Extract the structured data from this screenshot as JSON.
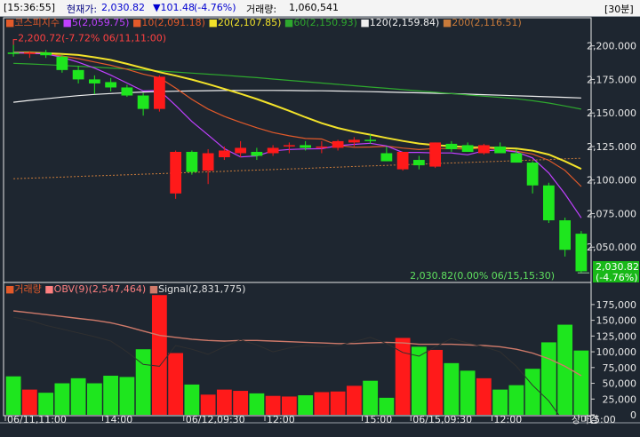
{
  "header": {
    "time": "[15:36:55]",
    "price_label": "현재가:",
    "price": "2,030.82",
    "change": "▼101.48",
    "change_pct": "(-4.76%)",
    "volume_label": "거래량:",
    "volume": "1,060,541",
    "interval": "[30분]"
  },
  "colors": {
    "background": "#1e2630",
    "up": "#ff1a1a",
    "down": "#1ee61e",
    "ma5": "#c040ff",
    "ma10": "#e35a2a",
    "ma20": "#f2e22a",
    "ma60": "#2ea82e",
    "ma120": "#f0f0f0",
    "ma200": "#c87a3a",
    "obv": "#ff6a6a",
    "signal": "#d07a6a"
  },
  "chart_data": [
    {
      "type": "candlestick",
      "title": "코스피지수",
      "legend": [
        {
          "name": "5",
          "value": "2,059.75"
        },
        {
          "name": "10",
          "value": "2,091.18"
        },
        {
          "name": "20",
          "value": "2,107.85"
        },
        {
          "name": "60",
          "value": "2,150.93"
        },
        {
          "name": "120",
          "value": "2,159.84"
        },
        {
          "name": "200",
          "value": "2,116.51"
        }
      ],
      "high_annotation": "2,200.72(-7.72% 06/11,11:00)",
      "low_annotation": "2,030.82(0.00% 06/15,15:30)",
      "last_price_box": [
        "2,030.82",
        "(-4.76%)"
      ],
      "y_ticks": [
        "2,200.000",
        "2,175.000",
        "2,150.000",
        "2,125.000",
        "2,100.000",
        "2,075.000",
        "2,050.000"
      ],
      "ylim": [
        2025,
        2213
      ],
      "candles": [
        {
          "o": 2195,
          "h": 2200.7,
          "l": 2192,
          "c": 2194
        },
        {
          "o": 2194,
          "h": 2196,
          "l": 2191,
          "c": 2195
        },
        {
          "o": 2195,
          "h": 2197,
          "l": 2191,
          "c": 2193
        },
        {
          "o": 2192,
          "h": 2193,
          "l": 2180,
          "c": 2182
        },
        {
          "o": 2182,
          "h": 2185,
          "l": 2172,
          "c": 2175
        },
        {
          "o": 2175,
          "h": 2178,
          "l": 2164,
          "c": 2172
        },
        {
          "o": 2173,
          "h": 2176,
          "l": 2166,
          "c": 2169
        },
        {
          "o": 2169,
          "h": 2171,
          "l": 2162,
          "c": 2163
        },
        {
          "o": 2163,
          "h": 2165,
          "l": 2148,
          "c": 2153
        },
        {
          "o": 2153,
          "h": 2178,
          "l": 2151,
          "c": 2177
        },
        {
          "o": 2090,
          "h": 2122,
          "l": 2086,
          "c": 2121
        },
        {
          "o": 2121,
          "h": 2122,
          "l": 2104,
          "c": 2106
        },
        {
          "o": 2107,
          "h": 2123,
          "l": 2097,
          "c": 2120
        },
        {
          "o": 2117,
          "h": 2125,
          "l": 2115,
          "c": 2122
        },
        {
          "o": 2120,
          "h": 2129,
          "l": 2117,
          "c": 2124
        },
        {
          "o": 2121,
          "h": 2124,
          "l": 2115,
          "c": 2118
        },
        {
          "o": 2120,
          "h": 2126,
          "l": 2118,
          "c": 2124
        },
        {
          "o": 2125,
          "h": 2128,
          "l": 2120,
          "c": 2126
        },
        {
          "o": 2126,
          "h": 2129,
          "l": 2122,
          "c": 2124
        },
        {
          "o": 2124,
          "h": 2129,
          "l": 2120,
          "c": 2125
        },
        {
          "o": 2124,
          "h": 2130,
          "l": 2122,
          "c": 2129
        },
        {
          "o": 2128,
          "h": 2132,
          "l": 2125,
          "c": 2130
        },
        {
          "o": 2130,
          "h": 2134,
          "l": 2127,
          "c": 2129
        },
        {
          "o": 2120,
          "h": 2125,
          "l": 2114,
          "c": 2114
        },
        {
          "o": 2108,
          "h": 2120,
          "l": 2107,
          "c": 2121
        },
        {
          "o": 2115,
          "h": 2118,
          "l": 2108,
          "c": 2111
        },
        {
          "o": 2110,
          "h": 2128,
          "l": 2109,
          "c": 2128
        },
        {
          "o": 2127,
          "h": 2129,
          "l": 2121,
          "c": 2123
        },
        {
          "o": 2126,
          "h": 2128,
          "l": 2121,
          "c": 2121
        },
        {
          "o": 2120,
          "h": 2127,
          "l": 2119,
          "c": 2126
        },
        {
          "o": 2125,
          "h": 2128,
          "l": 2120,
          "c": 2120
        },
        {
          "o": 2120,
          "h": 2123,
          "l": 2113,
          "c": 2113
        },
        {
          "o": 2113,
          "h": 2114,
          "l": 2090,
          "c": 2096
        },
        {
          "o": 2096,
          "h": 2098,
          "l": 2068,
          "c": 2070
        },
        {
          "o": 2070,
          "h": 2072,
          "l": 2043,
          "c": 2048
        },
        {
          "o": 2060,
          "h": 2062,
          "l": 2031,
          "c": 2032
        }
      ],
      "ma": {
        "ma5": [
          2195,
          2194.5,
          2194,
          2191.5,
          2187.8,
          2183.4,
          2178.2,
          2172.3,
          2166.4,
          2166.8,
          2155.6,
          2143.6,
          2133.6,
          2123.4,
          2117.2,
          2118,
          2121.8,
          2122.8,
          2123.2,
          2123.4,
          2125.6,
          2126.6,
          2127.4,
          2125.4,
          2120.6,
          2120.6,
          2120.2,
          2120.2,
          2118.8,
          2121.8,
          2122.4,
          2121,
          2116.5,
          2105.2,
          2089.6,
          2071.8
        ],
        "ma10": [
          2195,
          2194.5,
          2194,
          2192.5,
          2190.5,
          2188,
          2185.5,
          2182.5,
          2179,
          2176.2,
          2168.6,
          2160.1,
          2152.9,
          2147.4,
          2143,
          2139,
          2135.4,
          2133,
          2131,
          2130.6,
          2125.8,
          2124.4,
          2124.6,
          2125.2,
          2123.8,
          2122.7,
          2123.5,
          2123.5,
          2123,
          2124,
          2122.8,
          2121.5,
          2119.4,
          2114.7,
          2107.2,
          2095.2
        ],
        "ma20": [
          2195,
          2195,
          2194.5,
          2194,
          2193.2,
          2191.5,
          2189.5,
          2186.6,
          2183.5,
          2180.4,
          2177.8,
          2174.9,
          2171.5,
          2167.9,
          2164.3,
          2160.4,
          2156.1,
          2151.6,
          2146.8,
          2142.4,
          2138.8,
          2136,
          2133.8,
          2131.4,
          2129.1,
          2127.2,
          2126,
          2125.2,
          2124.5,
          2124.3,
          2123.9,
          2123.5,
          2121.9,
          2119,
          2114,
          2108.3
        ],
        "ma60": [
          2187,
          2186.5,
          2186,
          2185.4,
          2184.8,
          2184.2,
          2183.5,
          2182.8,
          2182,
          2181.3,
          2180.5,
          2179.7,
          2178.9,
          2178.1,
          2177.2,
          2176.3,
          2175.3,
          2174.3,
          2173.3,
          2172.3,
          2171.3,
          2170.3,
          2169.3,
          2168.4,
          2167.4,
          2166.4,
          2165.4,
          2164.4,
          2163.4,
          2162.5,
          2161.6,
          2160.6,
          2159.1,
          2157.4,
          2155.2,
          2152.8
        ],
        "ma120": [
          2158,
          2159.4,
          2160.6,
          2161.8,
          2162.9,
          2163.8,
          2164.5,
          2165.1,
          2165.6,
          2166,
          2166.2,
          2166.4,
          2166.6,
          2166.7,
          2166.8,
          2166.8,
          2166.8,
          2166.7,
          2166.6,
          2166.5,
          2166.3,
          2166.1,
          2165.9,
          2165.6,
          2165.3,
          2165,
          2164.7,
          2164.4,
          2164,
          2163.6,
          2163.2,
          2162.8,
          2162.4,
          2162,
          2161.6,
          2161.2
        ],
        "ma200": [
          2101,
          2101.4,
          2101.8,
          2102.2,
          2102.7,
          2103.1,
          2103.5,
          2103.9,
          2104.4,
          2104.8,
          2105.2,
          2105.7,
          2106.1,
          2106.5,
          2107,
          2107.4,
          2107.8,
          2108.3,
          2108.7,
          2109.2,
          2109.6,
          2110.1,
          2110.5,
          2110.9,
          2111.4,
          2111.8,
          2112.3,
          2112.7,
          2113.1,
          2113.6,
          2114,
          2114.5,
          2114.9,
          2115.3,
          2115.8,
          2116.2
        ]
      },
      "x_labels": [
        {
          "label": "06/11,11:00",
          "i": 0
        },
        {
          "label": "14:00",
          "i": 6
        },
        {
          "label": "06/12,09:30",
          "i": 11
        },
        {
          "label": "12:00",
          "i": 16
        },
        {
          "label": "15:00",
          "i": 22
        },
        {
          "label": "06/15,09:30",
          "i": 25
        },
        {
          "label": "12:00",
          "i": 30
        },
        {
          "label": "15:00",
          "i": 36
        }
      ]
    },
    {
      "type": "bar",
      "title": "거래량",
      "legend": [
        {
          "name": "OBV(9)",
          "value": "2,547,464"
        },
        {
          "name": "Signal",
          "value": "2,831,775"
        }
      ],
      "y_ticks": [
        "175,000",
        "150,000",
        "125,000",
        "100,000",
        "75,000",
        "50,000",
        "25,000",
        "0"
      ],
      "ylim": [
        0,
        187500
      ],
      "footer_label": "장마감",
      "volumes": [
        61000,
        40000,
        35000,
        50000,
        58000,
        50000,
        62000,
        60000,
        104000,
        190000,
        98000,
        48000,
        32000,
        40000,
        38000,
        34000,
        30000,
        29000,
        31000,
        36000,
        37000,
        46000,
        54000,
        27000,
        122000,
        108000,
        103000,
        82000,
        70000,
        58000,
        40000,
        47000,
        73000,
        115000,
        143000,
        102000
      ],
      "obv": [
        155000,
        150000,
        142000,
        136000,
        130000,
        124000,
        117000,
        100000,
        80000,
        77000,
        110000,
        104000,
        96000,
        108000,
        119000,
        111000,
        100000,
        106000,
        110000,
        108000,
        110000,
        116000,
        123000,
        113000,
        99000,
        93000,
        108000,
        121000,
        114000,
        108000,
        100000,
        77000,
        47000,
        22000,
        -14000,
        -44000
      ],
      "signal": [
        165000,
        162000,
        159000,
        156000,
        153000,
        150000,
        146000,
        140000,
        133000,
        126000,
        123000,
        120000,
        118000,
        117000,
        118000,
        118000,
        117000,
        116000,
        115000,
        114000,
        113000,
        113000,
        114000,
        115000,
        114000,
        112000,
        112000,
        112000,
        111000,
        110000,
        108000,
        104000,
        98000,
        89000,
        77000,
        62000
      ]
    }
  ]
}
